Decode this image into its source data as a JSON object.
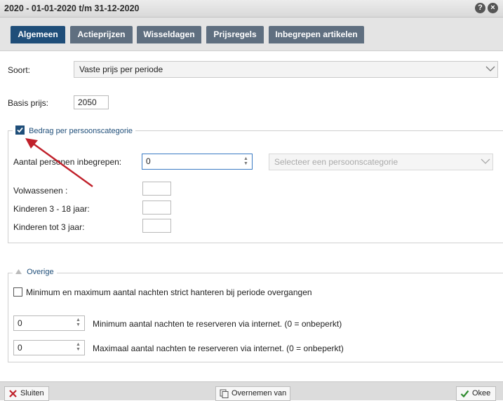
{
  "window": {
    "title": "2020 - 01-01-2020 t/m 31-12-2020",
    "help_icon": "?",
    "close_icon": "×"
  },
  "tabs": [
    {
      "label": "Algemeen",
      "active": true
    },
    {
      "label": "Actieprijzen",
      "active": false
    },
    {
      "label": "Wisseldagen",
      "active": false
    },
    {
      "label": "Prijsregels",
      "active": false
    },
    {
      "label": "Inbegrepen artikelen",
      "active": false
    }
  ],
  "form": {
    "soort_label": "Soort:",
    "soort_value": "Vaste prijs per periode",
    "basis_prijs_label": "Basis prijs:",
    "basis_prijs_value": "2050"
  },
  "persoonscategorie": {
    "legend": "Bedrag per persoonscategorie",
    "checked": true,
    "aantal_label": "Aantal personen inbegrepen:",
    "aantal_value": "0",
    "category_placeholder": "Selecteer een persoonscategorie",
    "rows": [
      {
        "label": "Volwassenen :",
        "value": ""
      },
      {
        "label": "Kinderen 3 - 18 jaar:",
        "value": ""
      },
      {
        "label": "Kinderen tot 3 jaar:",
        "value": ""
      }
    ]
  },
  "overige": {
    "legend": "Overige",
    "strict_label": "Minimum en maximum aantal nachten strict hanteren bij periode overgangen",
    "strict_checked": false,
    "min_value": "0",
    "min_label": "Minimum aantal nachten te reserveren via internet. (0 = onbeperkt)",
    "max_value": "0",
    "max_label": "Maximaal aantal nachten te reserveren via internet. (0 = onbeperkt)"
  },
  "footer": {
    "close_label": "Sluiten",
    "copy_label": "Overnemen van",
    "ok_label": "Okee"
  },
  "colors": {
    "tab_active": "#1f4e79",
    "tab_inactive": "#5f6f80",
    "annotation_arrow": "#c0202a"
  }
}
